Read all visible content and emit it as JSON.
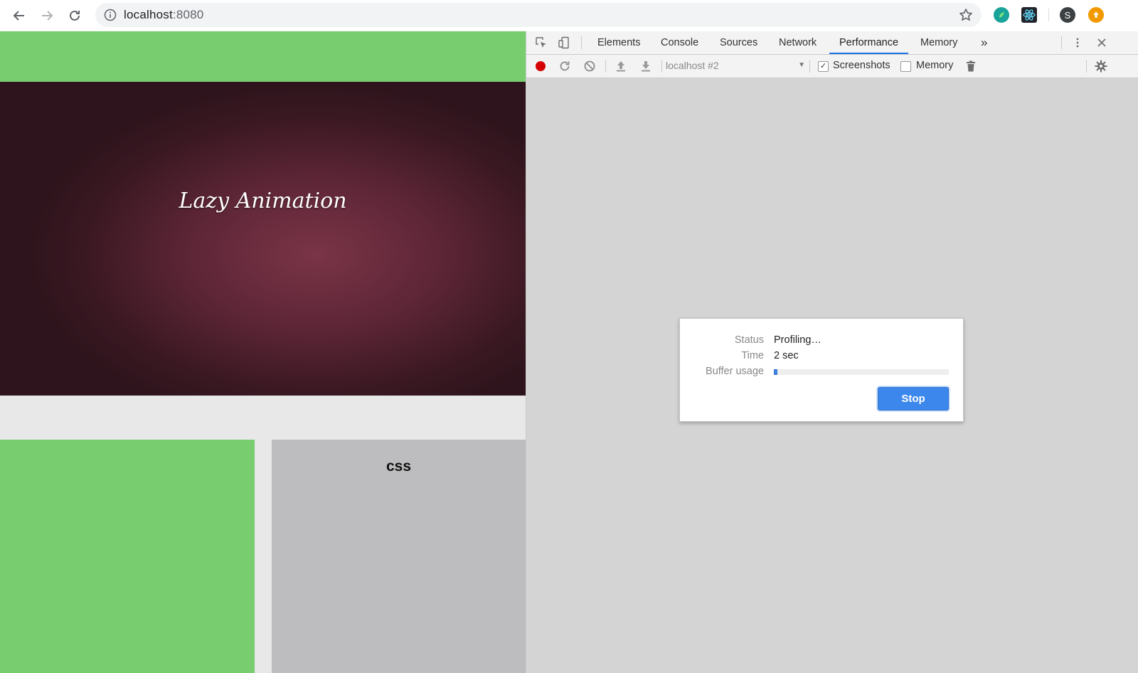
{
  "browser": {
    "address": {
      "host": "localhost",
      "port": ":8080"
    },
    "profile_initial": "S"
  },
  "page": {
    "hero_title": "Lazy Animation",
    "tile_label": "css",
    "colors": {
      "green": "#78cd6f",
      "gray": "#bdbdbf",
      "hero": "#5c2536"
    }
  },
  "devtools": {
    "tabs": [
      "Elements",
      "Console",
      "Sources",
      "Network",
      "Performance",
      "Memory"
    ],
    "active_tab": "Performance",
    "more_tabs": "»",
    "perf_toolbar": {
      "target": "localhost #2",
      "screenshots_label": "Screenshots",
      "screenshots_checked": true,
      "memory_label": "Memory",
      "memory_checked": false
    },
    "dialog": {
      "status_label": "Status",
      "status_value": "Profiling…",
      "time_label": "Time",
      "time_value": "2 sec",
      "buffer_label": "Buffer usage",
      "buffer_fraction": 0.02,
      "stop_label": "Stop"
    }
  }
}
